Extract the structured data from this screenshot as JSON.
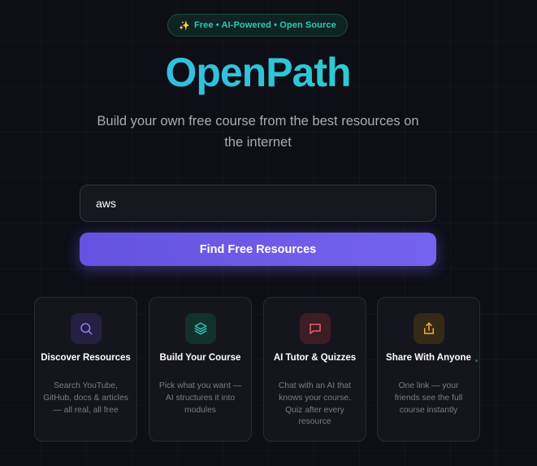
{
  "badge": {
    "icon": "sparkles-icon",
    "text": "Free • AI-Powered • Open Source"
  },
  "header": {
    "title": "OpenPath",
    "subtitle": "Build your own free course from the best resources on the internet"
  },
  "search": {
    "value": "aws",
    "placeholder": ""
  },
  "cta": {
    "label": "Find Free Resources"
  },
  "features": [
    {
      "icon": "search-icon",
      "title": "Discover Resources",
      "desc": "Search YouTube, GitHub, docs & articles — all real, all free",
      "accent": "#8b7cf6"
    },
    {
      "icon": "layers-icon",
      "title": "Build Your Course",
      "desc": "Pick what you want — AI structures it into modules",
      "accent": "#2cc9b4"
    },
    {
      "icon": "chat-icon",
      "title": "AI Tutor & Quizzes",
      "desc": "Chat with an AI that knows your course. Quiz after every resource",
      "accent": "#e8606a"
    },
    {
      "icon": "share-icon",
      "title": "Share With Anyone",
      "desc": "One link — your friends see the full course instantly",
      "accent": "#f0b23a"
    }
  ],
  "colors": {
    "background": "#0e0e16",
    "brand_gradient_start": "#3ab0f0",
    "brand_gradient_end": "#2fd1c4",
    "cta": "#6e5cea",
    "badge_text": "#2cc9b4"
  }
}
